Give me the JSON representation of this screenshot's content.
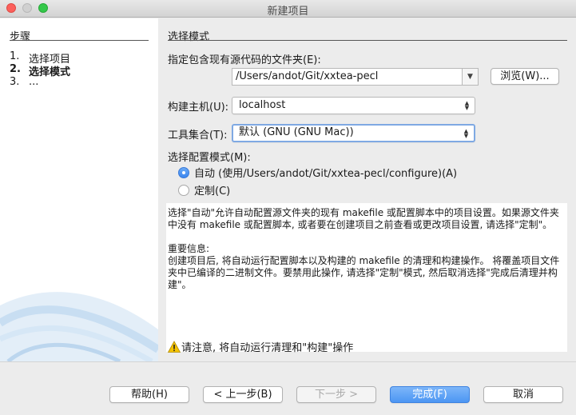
{
  "window": {
    "title": "新建项目"
  },
  "sidebar": {
    "heading": "步骤",
    "steps": [
      {
        "num": "1.",
        "label": "选择项目"
      },
      {
        "num": "2.",
        "label": "选择模式"
      },
      {
        "num": "3.",
        "label": "..."
      }
    ]
  },
  "main": {
    "heading": "选择模式",
    "source_folder": {
      "label": "指定包含现有源代码的文件夹(E):",
      "value": "/Users/andot/Git/xxtea-pecl",
      "browse_label": "浏览(W)..."
    },
    "build_host": {
      "label": "构建主机(U):",
      "value": "localhost"
    },
    "tool_collection": {
      "label": "工具集合(T):",
      "value": "默认 (GNU (GNU Mac))"
    },
    "config_mode": {
      "label": "选择配置模式(M):",
      "options": [
        {
          "label": "自动 (使用/Users/andot/Git/xxtea-pecl/configure)(A)",
          "checked": true
        },
        {
          "label": "定制(C)",
          "checked": false
        }
      ]
    },
    "info": {
      "para1": "选择\"自动\"允许自动配置源文件夹的现有 makefile 或配置脚本中的项目设置。如果源文件夹中没有 makefile 或配置脚本, 或者要在创建项目之前查看或更改项目设置, 请选择\"定制\"。",
      "para2_title": "重要信息:",
      "para2": "创建项目后, 将自动运行配置脚本以及构建的 makefile 的清理和构建操作。 将覆盖项目文件夹中已编译的二进制文件。要禁用此操作, 请选择\"定制\"模式, 然后取消选择\"完成后清理并构建\"。"
    },
    "warning": "请注意, 将自动运行清理和\"构建\"操作"
  },
  "footer": {
    "help_label": "帮助(H)",
    "back_label": "< 上一步(B)",
    "next_label": "下一步 >",
    "finish_label": "完成(F)",
    "cancel_label": "取消"
  },
  "icons": {
    "window_close": "close-icon",
    "window_minimize": "minimize-icon",
    "window_zoom": "zoom-icon",
    "warning": "warning-icon",
    "dropdown": "chevron-down-icon",
    "select_arrows": "up-down-arrows-icon"
  },
  "colors": {
    "close": "#fc605c",
    "zoom": "#34c84a",
    "primary_button": "#4c96f3",
    "focus_ring": "#7fa9e3",
    "warning": "#f5c400"
  }
}
